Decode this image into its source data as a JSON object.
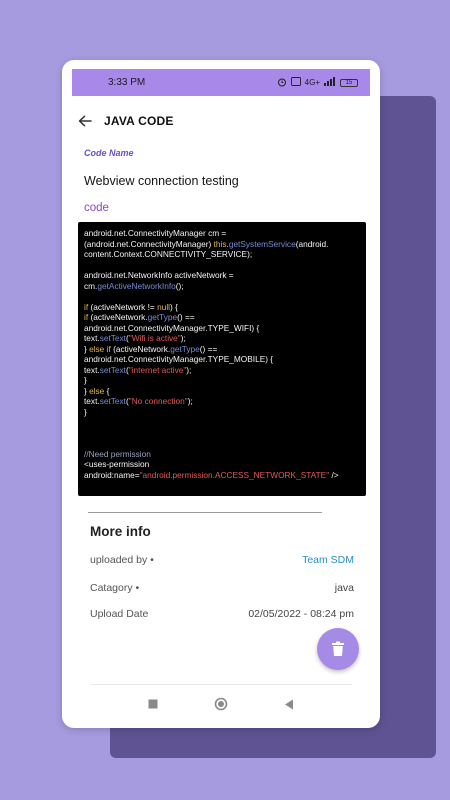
{
  "status_bar": {
    "time": "3:33 PM",
    "network": "4G+",
    "battery": "15"
  },
  "app_bar": {
    "title": "JAVA CODE"
  },
  "form": {
    "code_name_label": "Code Name",
    "code_name_value": "Webview connection testing",
    "code_label": "code"
  },
  "code_lines": [
    [
      {
        "t": "android.net.ConnectivityManager cm =",
        "c": ""
      }
    ],
    [
      {
        "t": "(android.net.ConnectivityManager) ",
        "c": ""
      },
      {
        "t": "this",
        "c": "kw"
      },
      {
        "t": ".",
        "c": ""
      },
      {
        "t": "getSystemService",
        "c": "fn"
      },
      {
        "t": "(android.",
        "c": ""
      }
    ],
    [
      {
        "t": "content.Context.CONNECTIVITY_SERVICE);",
        "c": ""
      }
    ],
    [
      {
        "t": "",
        "c": ""
      }
    ],
    [
      {
        "t": "android.net.NetworkInfo activeNetwork =",
        "c": ""
      }
    ],
    [
      {
        "t": "cm.",
        "c": ""
      },
      {
        "t": "getActiveNetworkInfo",
        "c": "fn"
      },
      {
        "t": "();",
        "c": ""
      }
    ],
    [
      {
        "t": "",
        "c": ""
      }
    ],
    [
      {
        "t": "if",
        "c": "kw"
      },
      {
        "t": " (activeNetwork != ",
        "c": ""
      },
      {
        "t": "null",
        "c": "kw"
      },
      {
        "t": ") {",
        "c": ""
      }
    ],
    [
      {
        "t": "if",
        "c": "kw"
      },
      {
        "t": " (activeNetwork.",
        "c": ""
      },
      {
        "t": "getType",
        "c": "fn"
      },
      {
        "t": "() ==",
        "c": ""
      }
    ],
    [
      {
        "t": "android.net.ConnectivityManager.TYPE_WIFI) {",
        "c": ""
      }
    ],
    [
      {
        "t": "text.",
        "c": ""
      },
      {
        "t": "setText",
        "c": "fn"
      },
      {
        "t": "(",
        "c": ""
      },
      {
        "t": "\"Wifi is active\"",
        "c": "str"
      },
      {
        "t": ");",
        "c": ""
      }
    ],
    [
      {
        "t": "} ",
        "c": ""
      },
      {
        "t": "else if",
        "c": "kw"
      },
      {
        "t": " (activeNetwork.",
        "c": ""
      },
      {
        "t": "getType",
        "c": "fn"
      },
      {
        "t": "() ==",
        "c": ""
      }
    ],
    [
      {
        "t": "android.net.ConnectivityManager.TYPE_MOBILE) {",
        "c": ""
      }
    ],
    [
      {
        "t": "text.",
        "c": ""
      },
      {
        "t": "setText",
        "c": "fn"
      },
      {
        "t": "(",
        "c": ""
      },
      {
        "t": "\"internet active\"",
        "c": "str"
      },
      {
        "t": ");",
        "c": ""
      }
    ],
    [
      {
        "t": "}",
        "c": ""
      }
    ],
    [
      {
        "t": "} ",
        "c": ""
      },
      {
        "t": "else",
        "c": "kw"
      },
      {
        "t": " {",
        "c": ""
      }
    ],
    [
      {
        "t": "text.",
        "c": ""
      },
      {
        "t": "setText",
        "c": "fn"
      },
      {
        "t": "(",
        "c": ""
      },
      {
        "t": "\"No connection\"",
        "c": "str"
      },
      {
        "t": ");",
        "c": ""
      }
    ],
    [
      {
        "t": "}",
        "c": ""
      }
    ],
    [
      {
        "t": "",
        "c": ""
      }
    ],
    [
      {
        "t": "",
        "c": ""
      }
    ],
    [
      {
        "t": "",
        "c": ""
      }
    ],
    [
      {
        "t": "//Need permission",
        "c": "cmt"
      }
    ],
    [
      {
        "t": "<uses-permission",
        "c": ""
      }
    ],
    [
      {
        "t": "android:name=",
        "c": ""
      },
      {
        "t": "\"android.permission.ACCESS_NETWORK_STATE\"",
        "c": "str"
      },
      {
        "t": " />",
        "c": ""
      }
    ]
  ],
  "more_info": {
    "title": "More info",
    "rows": [
      {
        "label": "uploaded by •",
        "value": "Team SDM"
      },
      {
        "label": "Catagory •",
        "value": "java"
      },
      {
        "label": "Upload Date",
        "value": "02/05/2022 - 08:24 pm"
      }
    ]
  },
  "colors": {
    "background": "#a79be0",
    "status_bar": "#a888e8",
    "accent": "#6a50c8",
    "fab": "#a58be6",
    "link": "#2a8ec8"
  },
  "icons": {
    "back": "arrow-left-icon",
    "fab": "trash-icon",
    "nav_recents": "square-icon",
    "nav_home": "circle-icon",
    "nav_back": "triangle-back-icon"
  }
}
